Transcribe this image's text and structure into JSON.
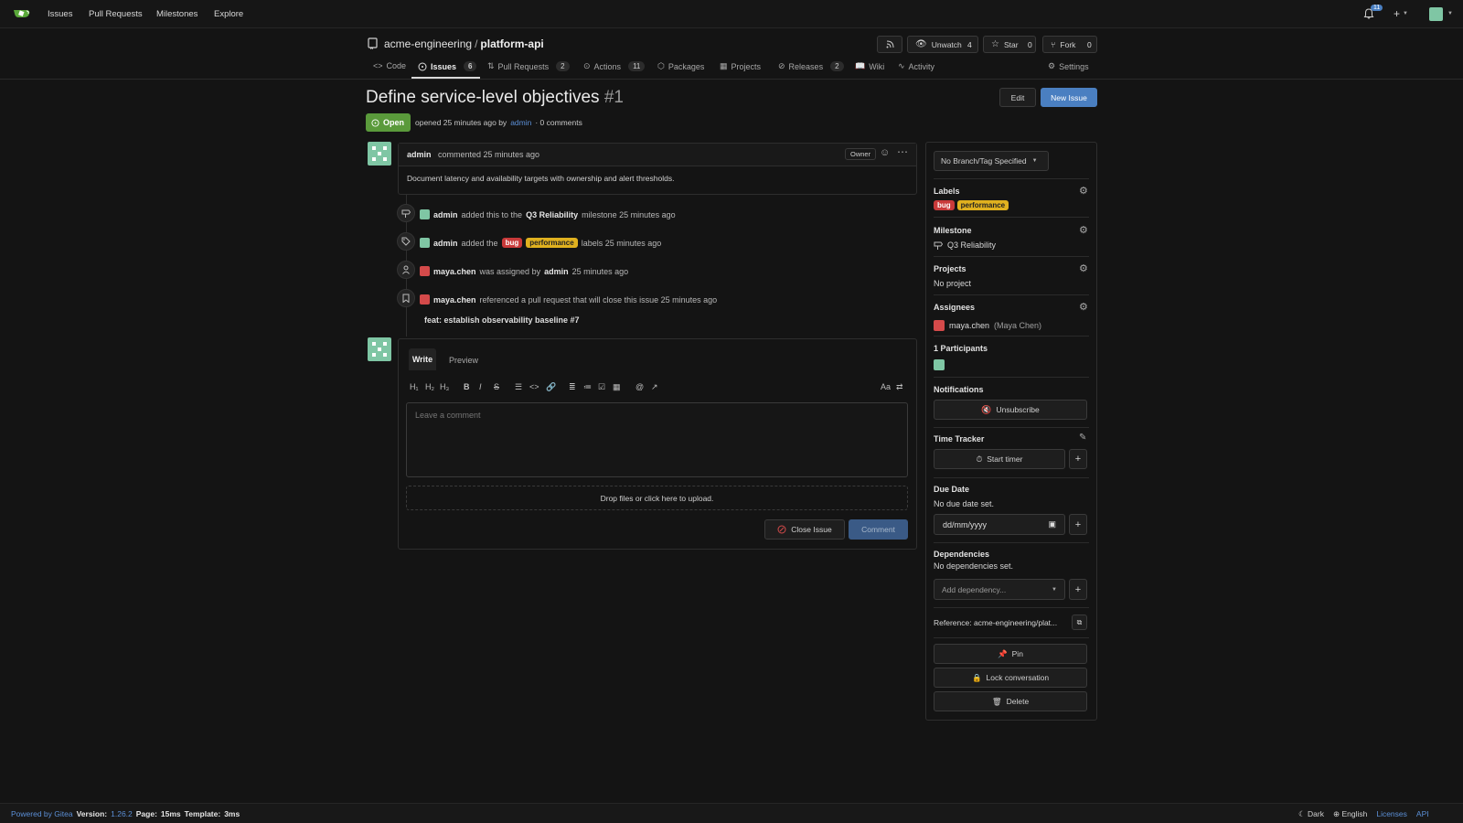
{
  "colors": {
    "accent": "#4a7fc1",
    "open": "#5a9a3b",
    "bug": "#c93a3a",
    "performance": "#e0b11f",
    "link": "#5b8fd6"
  },
  "nav": {
    "items": [
      "Issues",
      "Pull Requests",
      "Milestones",
      "Explore"
    ],
    "notif_count": "11"
  },
  "repo": {
    "owner": "acme-engineering",
    "name": "platform-api",
    "unwatch_label": "Unwatch",
    "unwatch_count": "4",
    "star_label": "Star",
    "star_count": "0",
    "fork_label": "Fork",
    "fork_count": "0"
  },
  "tabs": {
    "code": "Code",
    "issues": "Issues",
    "issues_count": "6",
    "pulls": "Pull Requests",
    "pulls_count": "2",
    "actions": "Actions",
    "actions_count": "11",
    "packages": "Packages",
    "projects": "Projects",
    "releases": "Releases",
    "releases_count": "2",
    "wiki": "Wiki",
    "activity": "Activity",
    "settings": "Settings"
  },
  "issue": {
    "title": "Define service-level objectives",
    "number": "#1",
    "state": "Open",
    "opened_prefix": "opened 25 minutes ago by",
    "author": "admin",
    "comments": "· 0 comments",
    "edit_label": "Edit",
    "new_issue_label": "New Issue"
  },
  "comment": {
    "author": "admin",
    "meta": "commented 25 minutes ago",
    "role": "Owner",
    "body": "Document latency and availability targets with ownership and alert thresholds."
  },
  "timeline": {
    "e1_user": "admin",
    "e1_a": "added this to the",
    "e1_milestone": "Q3 Reliability",
    "e1_b": "milestone 25 minutes ago",
    "e2_user": "admin",
    "e2_a": "added the",
    "e2_label1": "bug",
    "e2_label2": "performance",
    "e2_b": "labels 25 minutes ago",
    "e3_user": "maya.chen",
    "e3_a": "was assigned by",
    "e3_by": "admin",
    "e3_b": "25 minutes ago",
    "e4_user": "maya.chen",
    "e4_a": "referenced a pull request that will close this issue 25 minutes ago",
    "pr_title": "feat: establish observability baseline #7"
  },
  "editor": {
    "write_tab": "Write",
    "preview_tab": "Preview",
    "placeholder": "Leave a comment",
    "drop_text": "Drop files or click here to upload.",
    "close_label": "Close Issue",
    "comment_label": "Comment",
    "aa": "Aa"
  },
  "sidebar": {
    "branch": "No Branch/Tag Specified",
    "labels_title": "Labels",
    "label1": "bug",
    "label2": "performance",
    "milestone_title": "Milestone",
    "milestone": "Q3 Reliability",
    "projects_title": "Projects",
    "projects": "No project",
    "assignees_title": "Assignees",
    "assignee": "maya.chen",
    "assignee_full": "(Maya Chen)",
    "participants_title": "1 Participants",
    "notifications_title": "Notifications",
    "unsubscribe": "Unsubscribe",
    "time_title": "Time Tracker",
    "start_timer": "Start timer",
    "due_title": "Due Date",
    "due_none": "No due date set.",
    "date_placeholder": "dd/mm/yyyy",
    "deps_title": "Dependencies",
    "deps_none": "No dependencies set.",
    "add_dep": "Add dependency...",
    "reference": "Reference: acme-engineering/plat...",
    "pin": "Pin",
    "lock": "Lock conversation",
    "delete": "Delete"
  },
  "footer": {
    "powered": "Powered by Gitea",
    "version_label": "Version:",
    "version": "1.26.2",
    "page_label": "Page:",
    "page_time": "15ms",
    "template_label": "Template:",
    "template_time": "3ms",
    "dark": "Dark",
    "english": "English",
    "licenses": "Licenses",
    "api": "API"
  }
}
